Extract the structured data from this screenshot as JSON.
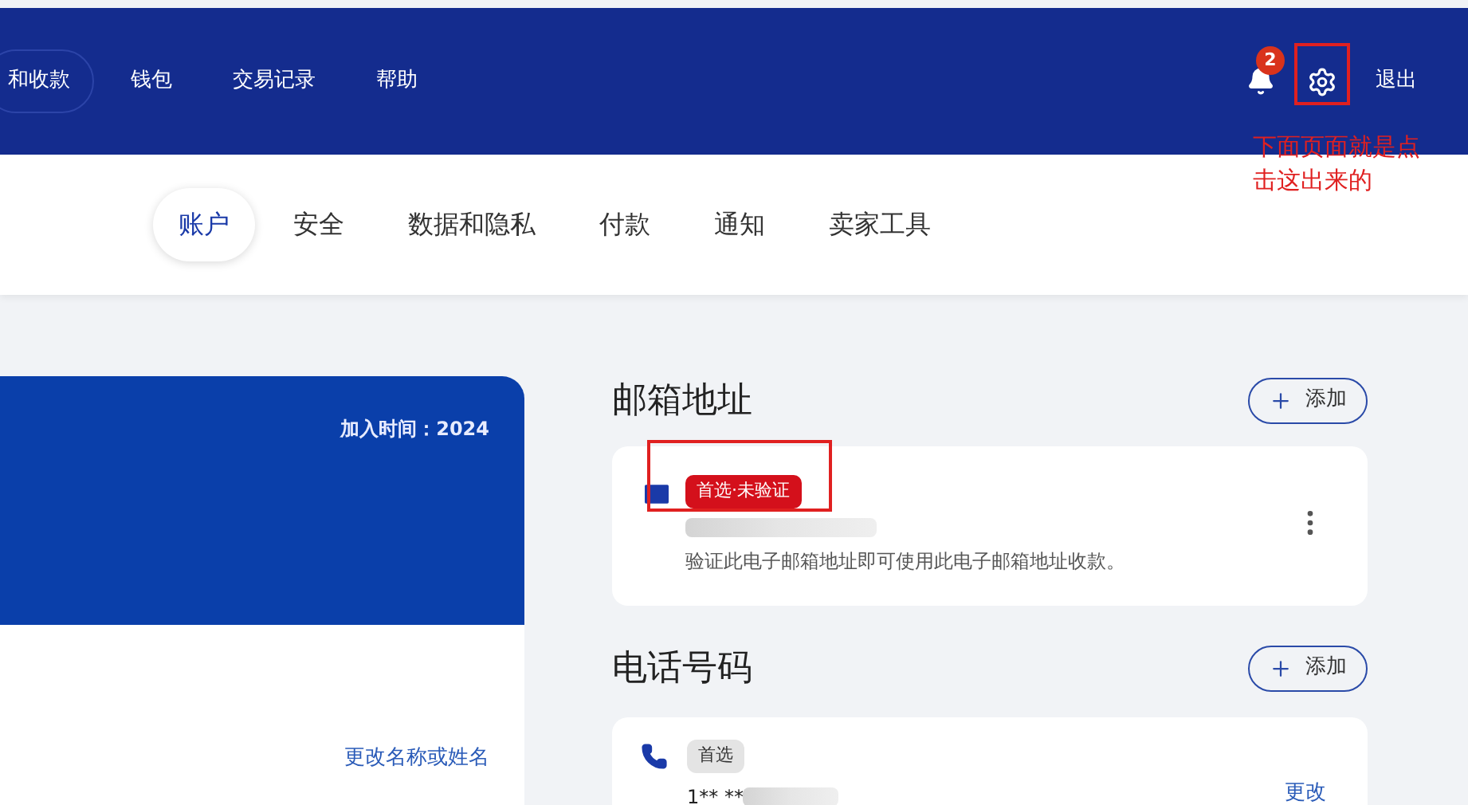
{
  "top_nav": {
    "items": [
      {
        "label": "和收款",
        "selected": true
      },
      {
        "label": "钱包",
        "selected": false
      },
      {
        "label": "交易记录",
        "selected": false
      },
      {
        "label": "帮助",
        "selected": false
      }
    ],
    "notification_count": "2",
    "logout": "退出"
  },
  "annotation": {
    "note": "下面页面就是点击这出来的"
  },
  "settings_tabs": [
    {
      "label": "账户",
      "selected": true
    },
    {
      "label": "安全",
      "selected": false
    },
    {
      "label": "数据和隐私",
      "selected": false
    },
    {
      "label": "付款",
      "selected": false
    },
    {
      "label": "通知",
      "selected": false
    },
    {
      "label": "卖家工具",
      "selected": false
    }
  ],
  "profile_card": {
    "joined": "加入时间：2024",
    "change_name_link": "更改名称或姓名"
  },
  "email_section": {
    "title": "邮箱地址",
    "add_button": "添加",
    "entries": [
      {
        "badge": "首选·未验证",
        "verified": false,
        "hint": "验证此电子邮箱地址即可使用此电子邮箱地址收款。"
      }
    ]
  },
  "phone_section": {
    "title": "电话号码",
    "add_button": "添加",
    "entries": [
      {
        "badge": "首选",
        "number": "1** **",
        "action": "更改"
      }
    ]
  }
}
